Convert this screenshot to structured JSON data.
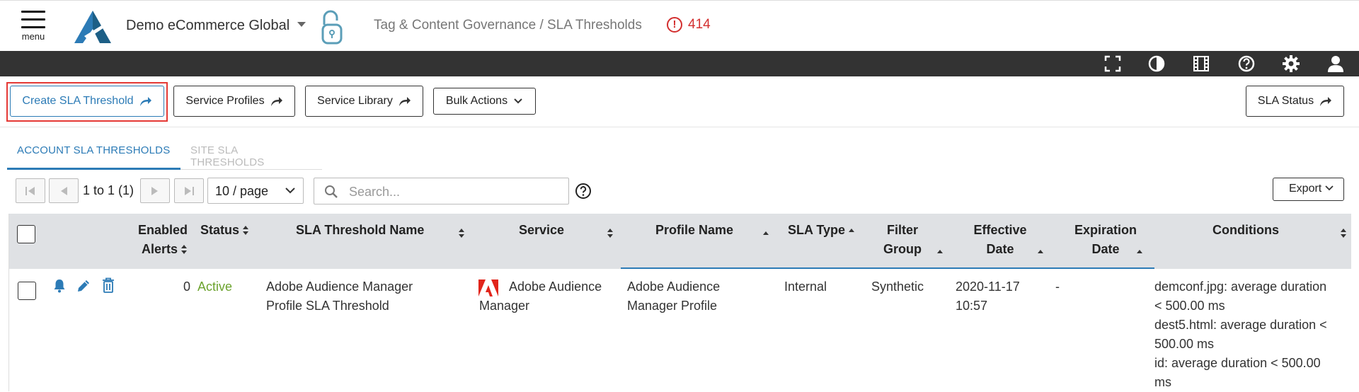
{
  "header": {
    "menu_label": "menu",
    "account_name": "Demo eCommerce Global",
    "breadcrumb": "Tag & Content Governance / SLA Thresholds",
    "alert_count": "414",
    "alert_symbol": "!"
  },
  "toolbar": {
    "icons": [
      "fullscreen-icon",
      "contrast-icon",
      "film-icon",
      "help-icon",
      "settings-icon",
      "user-icon"
    ]
  },
  "actions": {
    "create_label": "Create SLA Threshold",
    "service_profiles_label": "Service Profiles",
    "service_library_label": "Service Library",
    "bulk_actions_label": "Bulk Actions",
    "sla_status_label": "SLA Status"
  },
  "tabs": {
    "account": "ACCOUNT SLA THRESHOLDS",
    "site": "SITE SLA THRESHOLDS"
  },
  "pager": {
    "range": "1 to 1 (1)",
    "page_size": "10 / page",
    "search_placeholder": "Search...",
    "export_label": "Export"
  },
  "table": {
    "headers": {
      "enabled_alerts_1": "Enabled",
      "enabled_alerts_2": "Alerts",
      "status": "Status",
      "name": "SLA Threshold Name",
      "service": "Service",
      "profile": "Profile Name",
      "sla_type": "SLA Type",
      "filter_group_1": "Filter",
      "filter_group_2": "Group",
      "effective_1": "Effective",
      "effective_2": "Date",
      "expiration_1": "Expiration",
      "expiration_2": "Date",
      "conditions": "Conditions"
    },
    "rows": [
      {
        "enabled_alerts": "0",
        "status": "Active",
        "name_1": "Adobe Audience Manager",
        "name_2": "Profile SLA Threshold",
        "service_1": "Adobe Audience",
        "service_2": "Manager",
        "profile_1": "Adobe Audience",
        "profile_2": "Manager Profile",
        "sla_type": "Internal",
        "filter_group": "Synthetic",
        "effective_1": "2020-11-17",
        "effective_2": "10:57",
        "expiration": "-",
        "conditions": [
          "demconf.jpg: average duration",
          "< 500.00 ms",
          "dest5.html: average duration <",
          "500.00 ms",
          "id: average duration < 500.00",
          "ms"
        ]
      }
    ]
  },
  "colors": {
    "accent": "#2c7bb6",
    "alert": "#d32f2f",
    "active": "#6ca32e",
    "toolbar": "#333333",
    "table_header": "#dfe1e4",
    "highlight": "#e53935"
  }
}
